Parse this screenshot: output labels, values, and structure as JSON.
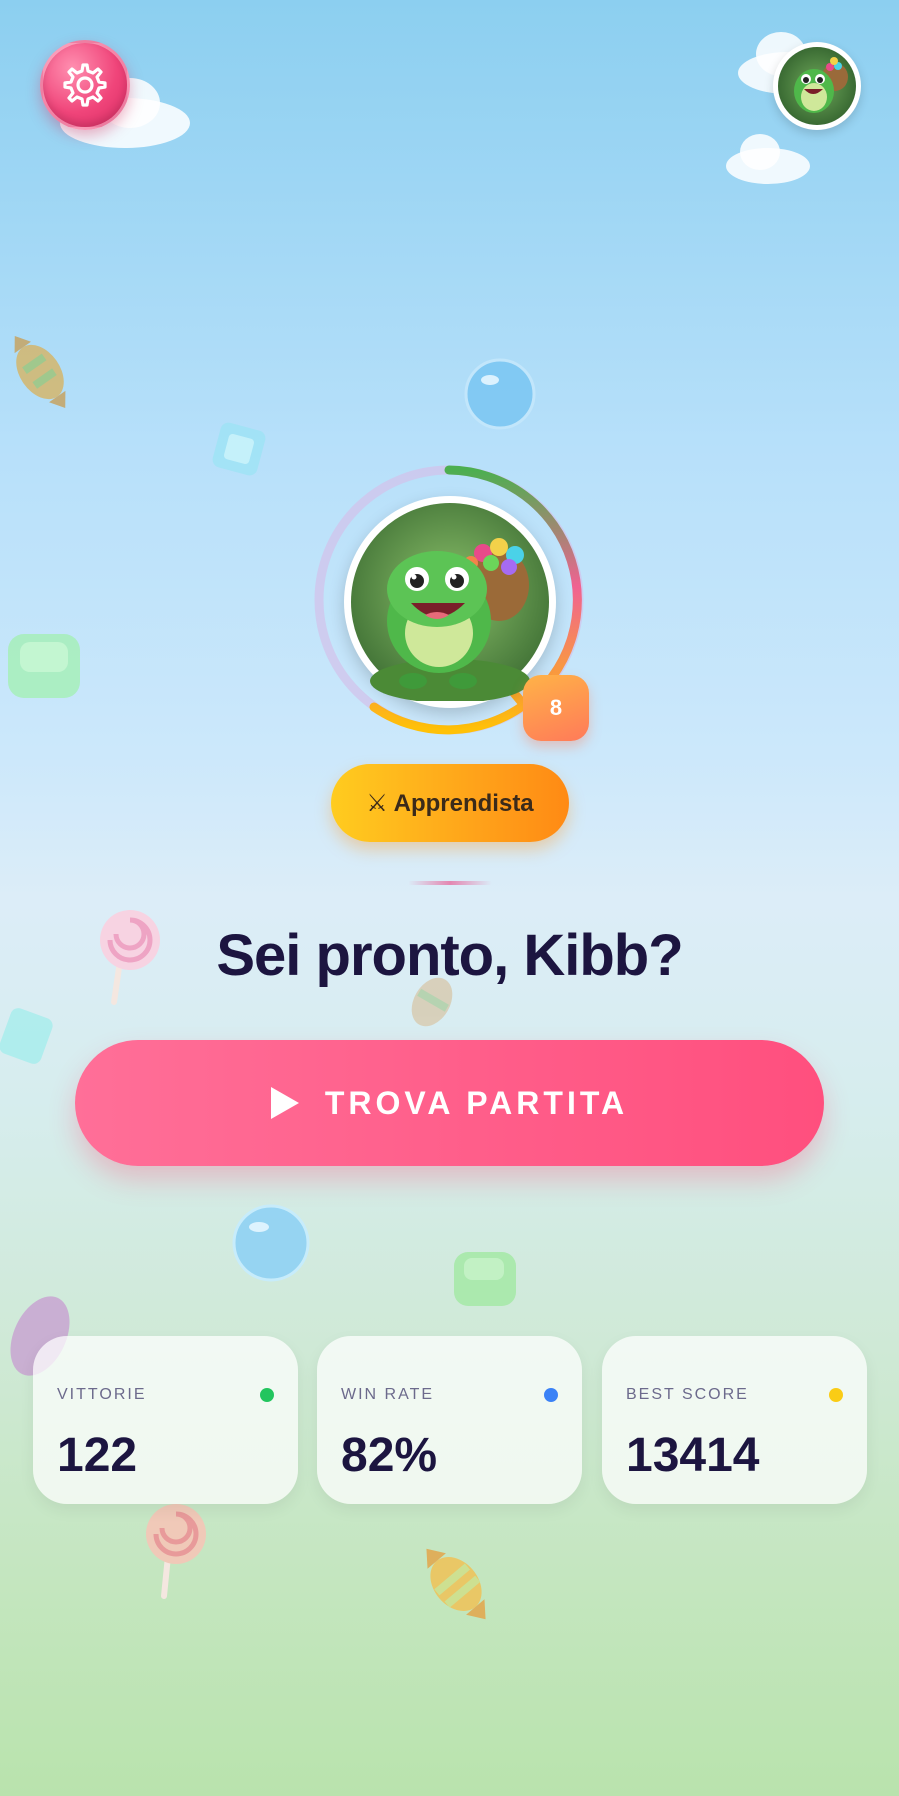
{
  "header": {
    "settings_icon": "gear-icon",
    "profile_icon": "dino-avatar-icon"
  },
  "profile": {
    "avatar_icon": "dino-avatar-icon",
    "level": "8",
    "rank_label": "⚔ Apprendista",
    "greeting": "Sei pronto, Kibb?"
  },
  "actions": {
    "find_match_label": "TROVA PARTITA",
    "find_match_icon": "play-icon"
  },
  "stats": [
    {
      "label": "VITTORIE",
      "value": "122",
      "dot_color": "#22c55e"
    },
    {
      "label": "WIN RATE",
      "value": "82%",
      "dot_color": "#3b82f6"
    },
    {
      "label": "BEST SCORE",
      "value": "13414",
      "dot_color": "#facc15"
    }
  ],
  "colors": {
    "accent": "#ff5582",
    "title_text": "#1c1540",
    "rank_gold": "#ffb21a"
  }
}
